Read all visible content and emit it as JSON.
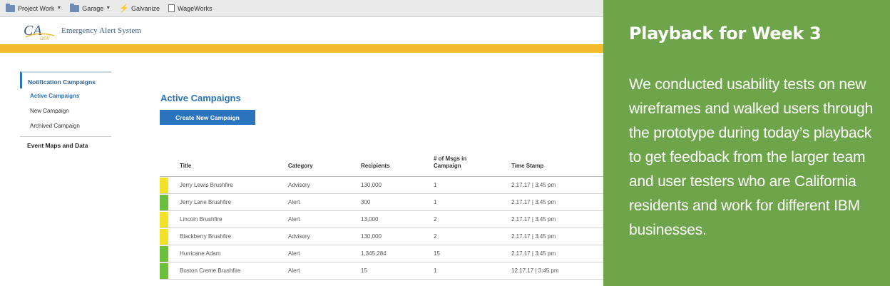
{
  "bookmarks": [
    {
      "label": "Project Work",
      "icon": "folder-icon",
      "dropdown": true
    },
    {
      "label": "Garage",
      "icon": "folder-icon",
      "dropdown": true
    },
    {
      "label": "Galvanize",
      "icon": "bolt-icon",
      "dropdown": false
    },
    {
      "label": "WageWorks",
      "icon": "document-icon",
      "dropdown": false
    }
  ],
  "header": {
    "logo_text": "CA.GOV",
    "app_title": "Emergency Alert System",
    "accent_color": "#f2b92b"
  },
  "sidebar": {
    "section1": "Notification Campaigns",
    "links": [
      {
        "label": "Active Campaigns",
        "active": true
      },
      {
        "label": "New Campaign",
        "active": false
      },
      {
        "label": "Archived Campaign",
        "active": false
      }
    ],
    "section2": "Event Maps and Data"
  },
  "main": {
    "title": "Active Campaigns",
    "create_button": "Create New Campaign",
    "columns": [
      "Title",
      "Category",
      "Recipients",
      "# of Msgs in Campaign",
      "Time Stamp"
    ],
    "rows": [
      {
        "title": "Jerry Lewis Brushfire",
        "category": "Advisory",
        "recipients": "130,000",
        "msgs": "1",
        "timestamp": "2.17.17 | 3:45 pm",
        "color": "#f2e12b"
      },
      {
        "title": "Jerry Lane Brushfire",
        "category": "Alert",
        "recipients": "300",
        "msgs": "1",
        "timestamp": "2.17.17 | 3:45 pm",
        "color": "#6bbf3a"
      },
      {
        "title": "Lincoln Brushfire",
        "category": "Alert",
        "recipients": "13,000",
        "msgs": "2",
        "timestamp": "2.17.17 | 3:45 pm",
        "color": "#f2e12b"
      },
      {
        "title": "Blackberry Brushfire",
        "category": "Advisory",
        "recipients": "130,000",
        "msgs": "2",
        "timestamp": "2.17.17 | 3:45 pm",
        "color": "#f2e12b"
      },
      {
        "title": "Hurricane Adam",
        "category": "Alert",
        "recipients": "1,345,284",
        "msgs": "15",
        "timestamp": "2.17.17 | 3:45 pm",
        "color": "#6bbf3a"
      },
      {
        "title": "Boston Creme Brushfire",
        "category": "Alert",
        "recipients": "15",
        "msgs": "1",
        "timestamp": "12.17.17 | 3:45 pm",
        "color": "#6bbf3a"
      }
    ]
  },
  "panel": {
    "title": "Playback for Week 3",
    "text": "We conducted usability tests on new wireframes and walked users through the prototype during today’s playback to get feedback from the larger team and user testers who are California residents and work for different IBM businesses.",
    "background": "#6ea54a"
  }
}
